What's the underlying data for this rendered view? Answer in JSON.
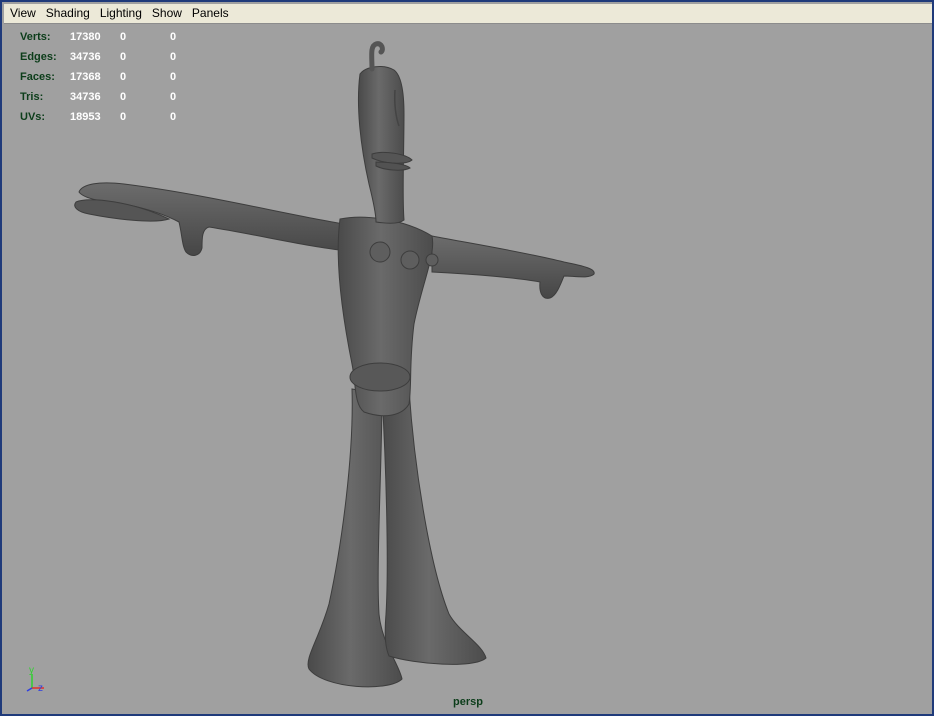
{
  "menu": [
    {
      "label": "View"
    },
    {
      "label": "Shading"
    },
    {
      "label": "Lighting"
    },
    {
      "label": "Show"
    },
    {
      "label": "Panels"
    }
  ],
  "hud": [
    {
      "label": "Verts:",
      "v1": "17380",
      "v2": "0",
      "v3": "0"
    },
    {
      "label": "Edges:",
      "v1": "34736",
      "v2": "0",
      "v3": "0"
    },
    {
      "label": "Faces:",
      "v1": "17368",
      "v2": "0",
      "v3": "0"
    },
    {
      "label": "Tris:",
      "v1": "34736",
      "v2": "0",
      "v3": "0"
    },
    {
      "label": "UVs:",
      "v1": "18953",
      "v2": "0",
      "v3": "0"
    }
  ],
  "camera": "persp",
  "axis": {
    "y_label": "y",
    "z_label": "z",
    "y_color": "#2fd12f",
    "x_color": "#e0302a",
    "z_color": "#2f3fe0"
  },
  "colors": {
    "background": "#a0a0a0",
    "model": "#5a5a5a",
    "hud_label": "#0c3d1a",
    "hud_value": "#ffffff",
    "frame": "#1f3a7a",
    "menubar": "#ece9d8"
  }
}
